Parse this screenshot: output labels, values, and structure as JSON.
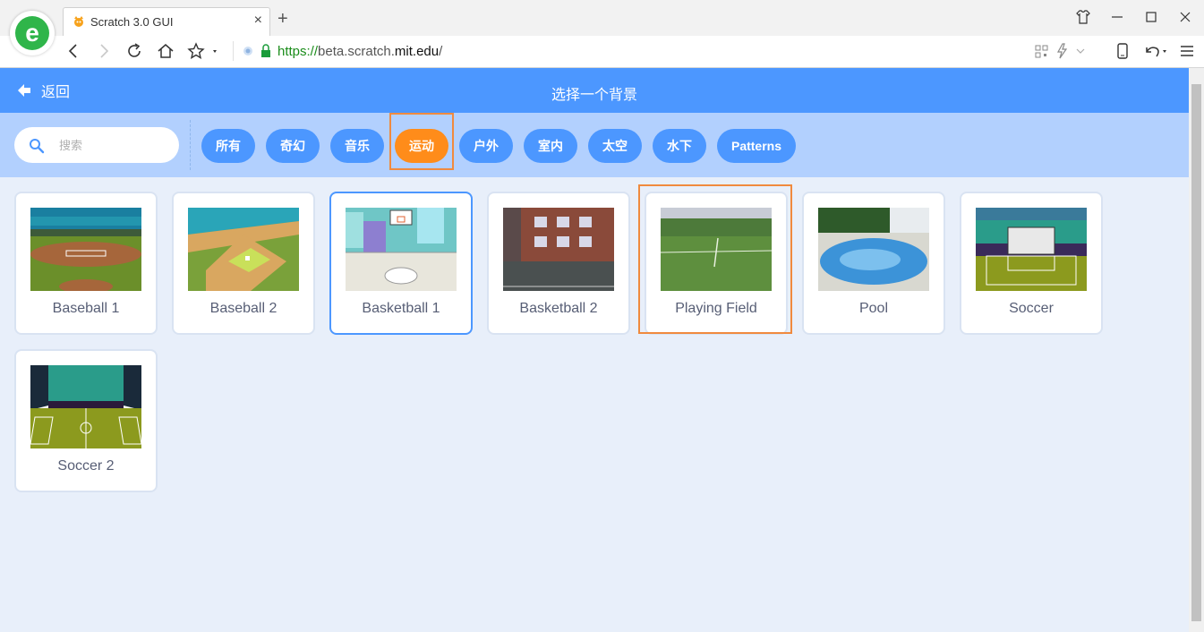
{
  "browser": {
    "tab_title": "Scratch 3.0 GUI",
    "tab_close": "×",
    "new_tab": "+",
    "url_scheme": "https://",
    "url_sub": "beta.scratch.",
    "url_domain": "mit.edu",
    "url_path": "/",
    "icons": [
      "browser-logo-icon",
      "scratch-cat-favicon",
      "back-icon",
      "forward-icon",
      "reload-icon",
      "home-icon",
      "star-icon",
      "secure-lock-icon",
      "qr-icon",
      "lightning-icon",
      "mobile-icon",
      "undo-icon",
      "menu-icon",
      "minimize-icon",
      "maximize-icon",
      "close-icon",
      "shirt-icon"
    ]
  },
  "header": {
    "back_label": "返回",
    "title": "选择一个背景"
  },
  "search": {
    "placeholder": "搜索"
  },
  "categories": [
    "所有",
    "奇幻",
    "音乐",
    "运动",
    "户外",
    "室内",
    "太空",
    "水下",
    "Patterns"
  ],
  "active_category": "运动",
  "backdrops": [
    {
      "name": "Baseball 1"
    },
    {
      "name": "Baseball 2"
    },
    {
      "name": "Basketball 1"
    },
    {
      "name": "Basketball 2"
    },
    {
      "name": "Playing Field"
    },
    {
      "name": "Pool"
    },
    {
      "name": "Soccer"
    },
    {
      "name": "Soccer 2"
    }
  ],
  "selected_backdrop": "Basketball 1",
  "colors": {
    "header_blue": "#4c97ff",
    "filter_bar": "#b2d0fe",
    "active_pill": "#ff8c1a",
    "highlight_box": "#f08a3e",
    "label_text": "#575e75"
  }
}
